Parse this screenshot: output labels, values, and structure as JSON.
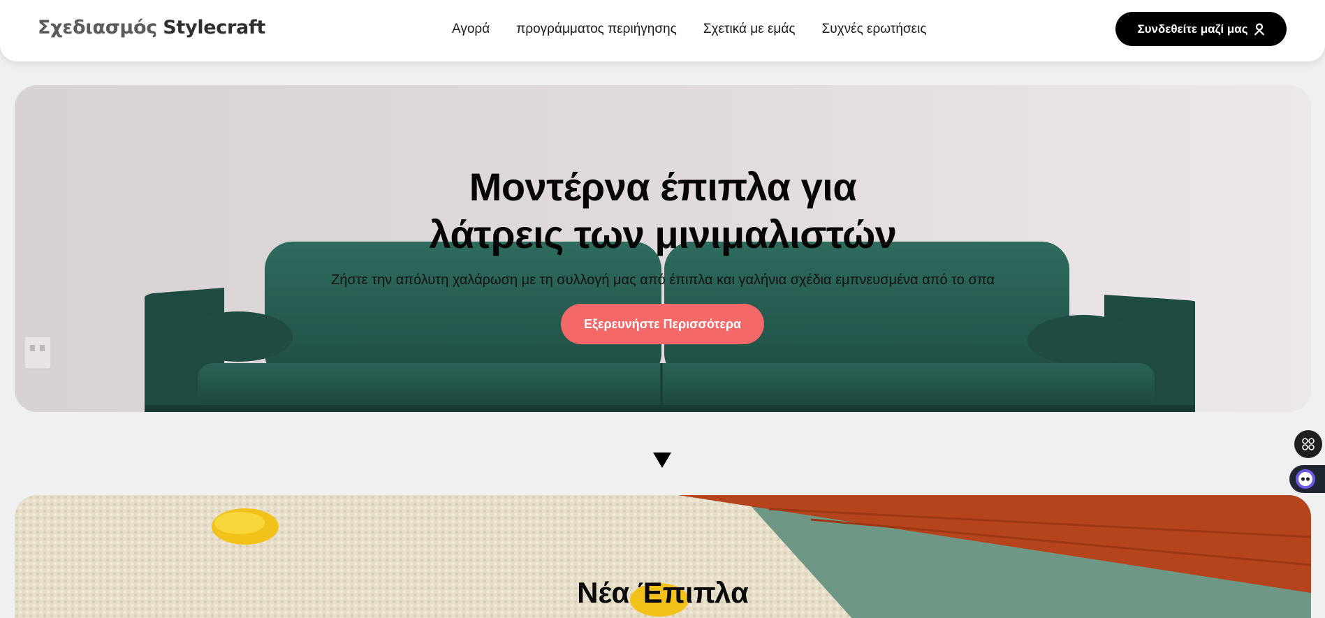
{
  "header": {
    "logo_prefix": "Σχεδιασμός",
    "logo_brand": "Stylecraft",
    "nav": [
      {
        "label": "Αγορά"
      },
      {
        "label": "προγράμματος περιήγησης"
      },
      {
        "label": "Σχετικά με εμάς"
      },
      {
        "label": "Συχνές ερωτήσεις"
      }
    ],
    "join_label": "Συνδεθείτε μαζί μας",
    "join_icon": "user-icon"
  },
  "hero": {
    "title_line1": "Μοντέρνα έπιπλα για",
    "title_line2": "λάτρεις των μινιμαλιστών",
    "subtitle": "Ζήστε την απόλυτη χαλάρωση με τη συλλογή μας από έπιπλα και γαλήνια σχέδια εμπνευσμένα από το σπα",
    "cta_label": "Εξερευνήστε Περισσότερα",
    "image": "green-velvet-sofa"
  },
  "scroll_indicator": "down-triangle-icon",
  "section2": {
    "title": "Νέα Έπιπλα",
    "image": "rug-lemons-orange-furniture"
  },
  "widgets": {
    "apps_icon": "apps-grid-icon",
    "bot_icon": "assistant-bot-icon"
  },
  "colors": {
    "accent_button": "#f56868",
    "primary_button": "#000000",
    "background": "#f0f0f0",
    "sofa": "#24574d"
  }
}
